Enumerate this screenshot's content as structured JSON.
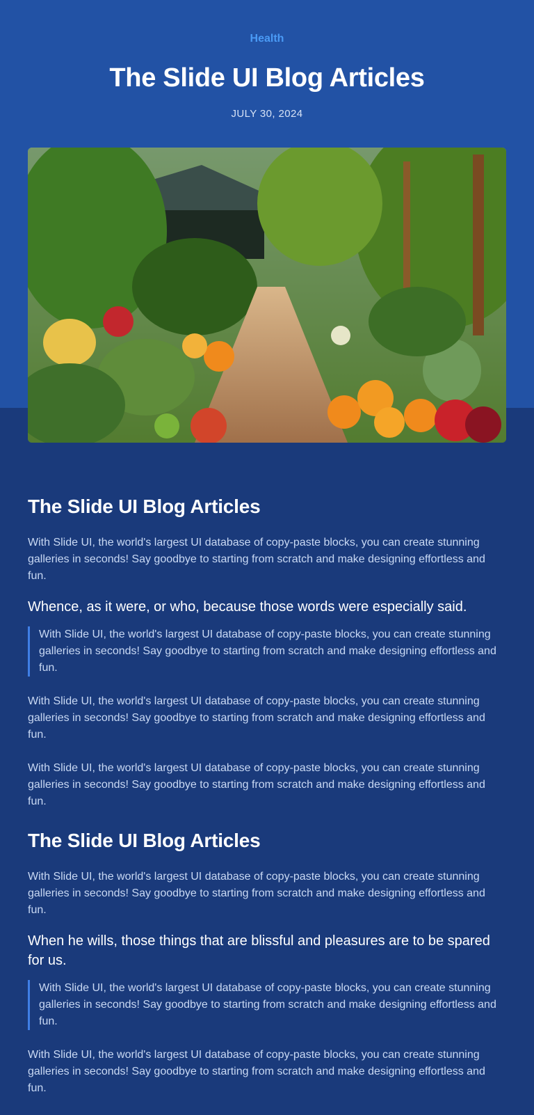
{
  "header": {
    "category": "Health",
    "title": "The Slide UI Blog Articles",
    "date": "JULY 30, 2024"
  },
  "hero_image": {
    "subject": "garden-with-vegetables-image"
  },
  "article": {
    "section1_title": "The Slide UI Blog Articles",
    "section1_p1": "With Slide UI, the world's largest UI database of copy-paste blocks, you can create stunning galleries in seconds! Say goodbye to starting from scratch and make designing effortless and fun.",
    "section1_subheading": "Whence, as it were, or who, because those words were especially said.",
    "section1_quote": "With Slide UI, the world's largest UI database of copy-paste blocks, you can create stunning galleries in seconds! Say goodbye to starting from scratch and make designing effortless and fun.",
    "section1_p2": "With Slide UI, the world's largest UI database of copy-paste blocks, you can create stunning galleries in seconds! Say goodbye to starting from scratch and make designing effortless and fun.",
    "section1_p3": "With Slide UI, the world's largest UI database of copy-paste blocks, you can create stunning galleries in seconds! Say goodbye to starting from scratch and make designing effortless and fun.",
    "section2_title": "The Slide UI Blog Articles",
    "section2_p1": "With Slide UI, the world's largest UI database of copy-paste blocks, you can create stunning galleries in seconds! Say goodbye to starting from scratch and make designing effortless and fun.",
    "section2_subheading": "When he wills, those things that are blissful and pleasures are to be spared for us.",
    "section2_quote": "With Slide UI, the world's largest UI database of copy-paste blocks, you can create stunning galleries in seconds! Say goodbye to starting from scratch and make designing effortless and fun.",
    "section2_p2": "With Slide UI, the world's largest UI database of copy-paste blocks, you can create stunning galleries in seconds! Say goodbye to starting from scratch and make designing effortless and fun."
  },
  "colors": {
    "hero_background": "#2252a5",
    "page_background": "#1a3a7b",
    "accent": "#4a9af5",
    "quote_border": "#3f7fe6"
  }
}
